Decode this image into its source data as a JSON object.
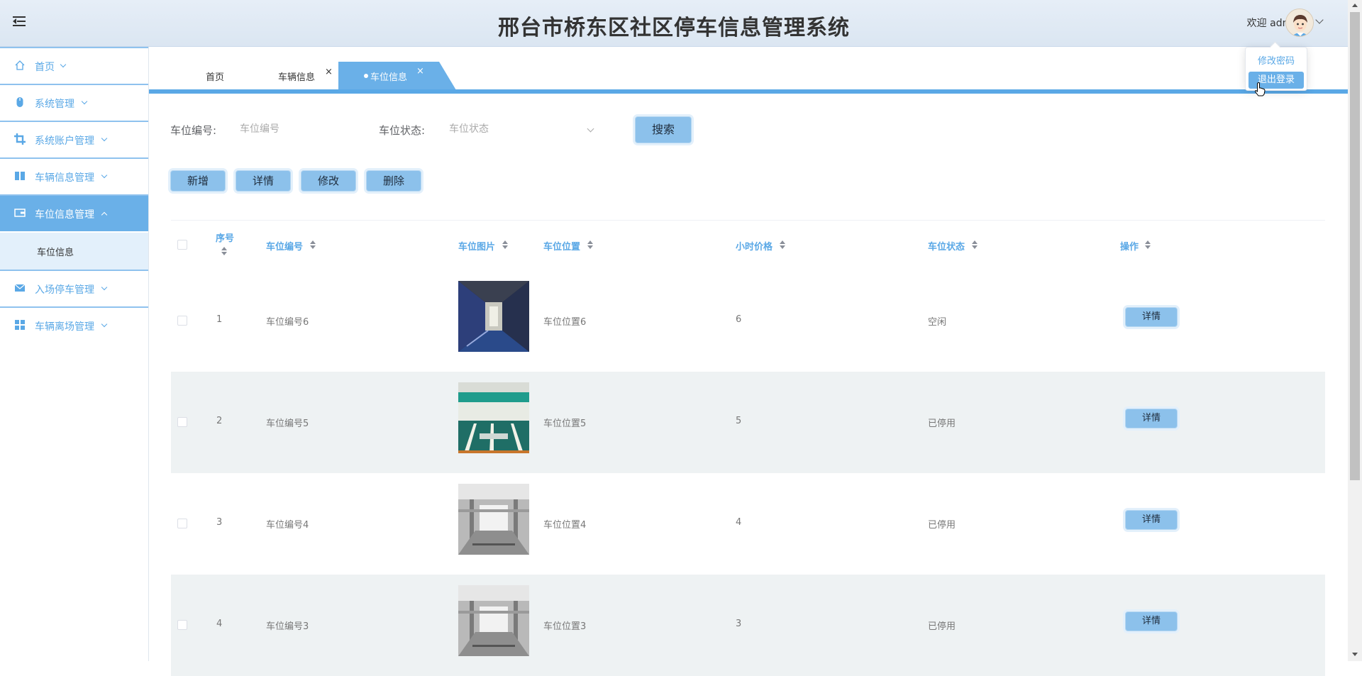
{
  "header": {
    "title": "邢台市桥东区社区停车信息管理系统",
    "welcome": "欢迎 admin",
    "menu": [
      "修改密码",
      "退出登录"
    ]
  },
  "sidebar": {
    "items": [
      {
        "label": "首页",
        "icon": "home-icon"
      },
      {
        "label": "系统管理",
        "icon": "mouse-icon"
      },
      {
        "label": "系统账户管理",
        "icon": "crop-icon"
      },
      {
        "label": "车辆信息管理",
        "icon": "book-icon"
      },
      {
        "label": "车位信息管理",
        "icon": "wallet-icon"
      },
      {
        "label": "入场停车管理",
        "icon": "envelope-icon"
      },
      {
        "label": "车辆离场管理",
        "icon": "grid-icon"
      }
    ],
    "sub_item": "车位信息"
  },
  "tabs": [
    {
      "label": "首页"
    },
    {
      "label": "车辆信息",
      "close": "×"
    },
    {
      "label": "车位信息",
      "close": "×",
      "active": true
    }
  ],
  "search": {
    "code_label": "车位编号:",
    "code_placeholder": "车位编号",
    "status_label": "车位状态:",
    "status_placeholder": "车位状态",
    "button": "搜索"
  },
  "actions": [
    "新增",
    "详情",
    "修改",
    "删除"
  ],
  "table": {
    "columns": [
      "序号",
      "车位编号",
      "车位图片",
      "车位位置",
      "小时价格",
      "车位状态",
      "操作"
    ],
    "rows": [
      {
        "index": "1",
        "code": "车位编号6",
        "location": "车位位置6",
        "price": "6",
        "status": "空闲",
        "action": "详情"
      },
      {
        "index": "2",
        "code": "车位编号5",
        "location": "车位位置5",
        "price": "5",
        "status": "已停用",
        "action": "详情"
      },
      {
        "index": "3",
        "code": "车位编号4",
        "location": "车位位置4",
        "price": "4",
        "status": "已停用",
        "action": "详情"
      },
      {
        "index": "4",
        "code": "车位编号3",
        "location": "车位位置3",
        "price": "3",
        "status": "已停用",
        "action": "详情"
      }
    ]
  },
  "colors": {
    "accent": "#5aa8e6",
    "active_bg": "#6ab0e8",
    "button_bg": "#8cc1eb",
    "header_bg": "#dbe6f2"
  }
}
